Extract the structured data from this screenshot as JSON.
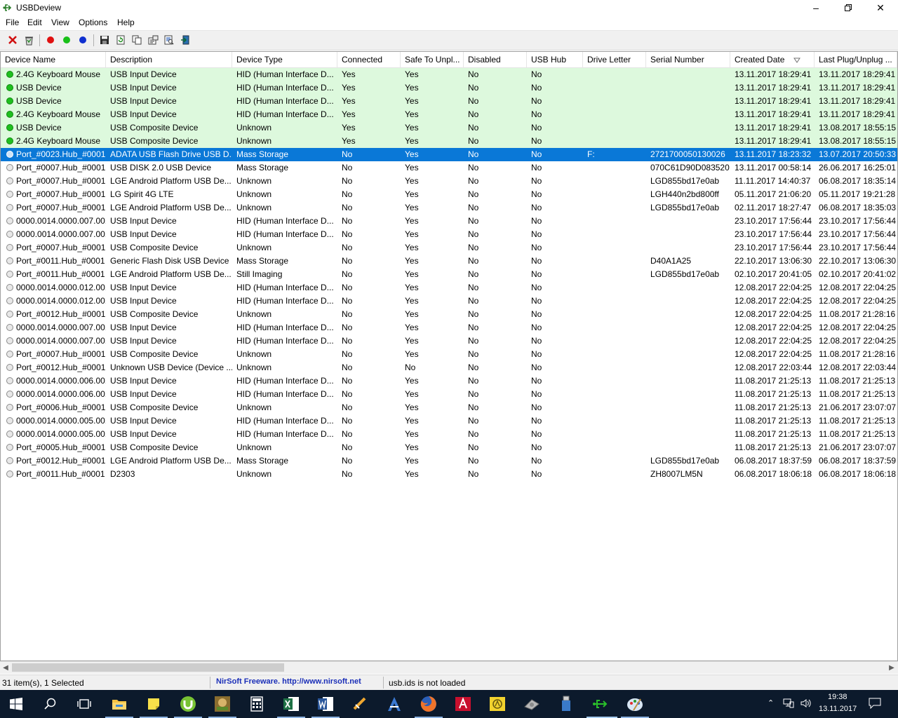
{
  "window": {
    "title": "USBDeview"
  },
  "menu": [
    "File",
    "Edit",
    "View",
    "Options",
    "Help"
  ],
  "columns": [
    "Device Name",
    "Description",
    "Device Type",
    "Connected",
    "Safe To Unpl...",
    "Disabled",
    "USB Hub",
    "Drive Letter",
    "Serial Number",
    "Created Date",
    "Last Plug/Unplug ..."
  ],
  "rows": [
    {
      "state": "connected",
      "cells": [
        "2.4G Keyboard Mouse",
        "USB Input Device",
        "HID (Human Interface D...",
        "Yes",
        "Yes",
        "No",
        "No",
        "",
        "",
        "13.11.2017 18:29:41",
        "13.11.2017 18:29:41"
      ]
    },
    {
      "state": "connected",
      "cells": [
        "USB Device",
        "USB Input Device",
        "HID (Human Interface D...",
        "Yes",
        "Yes",
        "No",
        "No",
        "",
        "",
        "13.11.2017 18:29:41",
        "13.11.2017 18:29:41"
      ]
    },
    {
      "state": "connected",
      "cells": [
        "USB Device",
        "USB Input Device",
        "HID (Human Interface D...",
        "Yes",
        "Yes",
        "No",
        "No",
        "",
        "",
        "13.11.2017 18:29:41",
        "13.11.2017 18:29:41"
      ]
    },
    {
      "state": "connected",
      "cells": [
        "2.4G Keyboard Mouse",
        "USB Input Device",
        "HID (Human Interface D...",
        "Yes",
        "Yes",
        "No",
        "No",
        "",
        "",
        "13.11.2017 18:29:41",
        "13.11.2017 18:29:41"
      ]
    },
    {
      "state": "connected",
      "cells": [
        "USB Device",
        "USB Composite Device",
        "Unknown",
        "Yes",
        "Yes",
        "No",
        "No",
        "",
        "",
        "13.11.2017 18:29:41",
        "13.08.2017 18:55:15"
      ]
    },
    {
      "state": "connected",
      "cells": [
        "2.4G Keyboard Mouse",
        "USB Composite Device",
        "Unknown",
        "Yes",
        "Yes",
        "No",
        "No",
        "",
        "",
        "13.11.2017 18:29:41",
        "13.08.2017 18:55:15"
      ]
    },
    {
      "state": "selected",
      "cells": [
        "Port_#0023.Hub_#0001",
        "ADATA USB Flash Drive USB D...",
        "Mass Storage",
        "No",
        "Yes",
        "No",
        "No",
        "F:",
        "2721700050130026",
        "13.11.2017 18:23:32",
        "13.07.2017 20:50:33"
      ]
    },
    {
      "state": "disconnected",
      "cells": [
        "Port_#0007.Hub_#0001",
        "USB DISK 2.0 USB Device",
        "Mass Storage",
        "No",
        "Yes",
        "No",
        "No",
        "",
        "070C61D90D083520",
        "13.11.2017 00:58:14",
        "26.06.2017 16:25:01"
      ]
    },
    {
      "state": "disconnected",
      "cells": [
        "Port_#0007.Hub_#0001",
        "LGE Android Platform USB De...",
        "Unknown",
        "No",
        "Yes",
        "No",
        "No",
        "",
        "LGD855bd17e0ab",
        "11.11.2017 14:40:37",
        "06.08.2017 18:35:14"
      ]
    },
    {
      "state": "disconnected",
      "cells": [
        "Port_#0007.Hub_#0001",
        "LG Spirit 4G LTE",
        "Unknown",
        "No",
        "Yes",
        "No",
        "No",
        "",
        "LGH440n2bd800ff",
        "05.11.2017 21:06:20",
        "05.11.2017 19:21:28"
      ]
    },
    {
      "state": "disconnected",
      "cells": [
        "Port_#0007.Hub_#0001",
        "LGE Android Platform USB De...",
        "Unknown",
        "No",
        "Yes",
        "No",
        "No",
        "",
        "LGD855bd17e0ab",
        "02.11.2017 18:27:47",
        "06.08.2017 18:35:03"
      ]
    },
    {
      "state": "disconnected",
      "cells": [
        "0000.0014.0000.007.00...",
        "USB Input Device",
        "HID (Human Interface D...",
        "No",
        "Yes",
        "No",
        "No",
        "",
        "",
        "23.10.2017 17:56:44",
        "23.10.2017 17:56:44"
      ]
    },
    {
      "state": "disconnected",
      "cells": [
        "0000.0014.0000.007.00...",
        "USB Input Device",
        "HID (Human Interface D...",
        "No",
        "Yes",
        "No",
        "No",
        "",
        "",
        "23.10.2017 17:56:44",
        "23.10.2017 17:56:44"
      ]
    },
    {
      "state": "disconnected",
      "cells": [
        "Port_#0007.Hub_#0001",
        "USB Composite Device",
        "Unknown",
        "No",
        "Yes",
        "No",
        "No",
        "",
        "",
        "23.10.2017 17:56:44",
        "23.10.2017 17:56:44"
      ]
    },
    {
      "state": "disconnected",
      "cells": [
        "Port_#0011.Hub_#0001",
        "Generic Flash Disk USB Device",
        "Mass Storage",
        "No",
        "Yes",
        "No",
        "No",
        "",
        "D40A1A25",
        "22.10.2017 13:06:30",
        "22.10.2017 13:06:30"
      ]
    },
    {
      "state": "disconnected",
      "cells": [
        "Port_#0011.Hub_#0001",
        "LGE Android Platform USB De...",
        "Still Imaging",
        "No",
        "Yes",
        "No",
        "No",
        "",
        "LGD855bd17e0ab",
        "02.10.2017 20:41:05",
        "02.10.2017 20:41:02"
      ]
    },
    {
      "state": "disconnected",
      "cells": [
        "0000.0014.0000.012.00...",
        "USB Input Device",
        "HID (Human Interface D...",
        "No",
        "Yes",
        "No",
        "No",
        "",
        "",
        "12.08.2017 22:04:25",
        "12.08.2017 22:04:25"
      ]
    },
    {
      "state": "disconnected",
      "cells": [
        "0000.0014.0000.012.00...",
        "USB Input Device",
        "HID (Human Interface D...",
        "No",
        "Yes",
        "No",
        "No",
        "",
        "",
        "12.08.2017 22:04:25",
        "12.08.2017 22:04:25"
      ]
    },
    {
      "state": "disconnected",
      "cells": [
        "Port_#0012.Hub_#0001",
        "USB Composite Device",
        "Unknown",
        "No",
        "Yes",
        "No",
        "No",
        "",
        "",
        "12.08.2017 22:04:25",
        "11.08.2017 21:28:16"
      ]
    },
    {
      "state": "disconnected",
      "cells": [
        "0000.0014.0000.007.00...",
        "USB Input Device",
        "HID (Human Interface D...",
        "No",
        "Yes",
        "No",
        "No",
        "",
        "",
        "12.08.2017 22:04:25",
        "12.08.2017 22:04:25"
      ]
    },
    {
      "state": "disconnected",
      "cells": [
        "0000.0014.0000.007.00...",
        "USB Input Device",
        "HID (Human Interface D...",
        "No",
        "Yes",
        "No",
        "No",
        "",
        "",
        "12.08.2017 22:04:25",
        "12.08.2017 22:04:25"
      ]
    },
    {
      "state": "disconnected",
      "cells": [
        "Port_#0007.Hub_#0001",
        "USB Composite Device",
        "Unknown",
        "No",
        "Yes",
        "No",
        "No",
        "",
        "",
        "12.08.2017 22:04:25",
        "11.08.2017 21:28:16"
      ]
    },
    {
      "state": "disconnected",
      "cells": [
        "Port_#0012.Hub_#0001",
        "Unknown USB Device (Device ...",
        "Unknown",
        "No",
        "No",
        "No",
        "No",
        "",
        "",
        "12.08.2017 22:03:44",
        "12.08.2017 22:03:44"
      ]
    },
    {
      "state": "disconnected",
      "cells": [
        "0000.0014.0000.006.00...",
        "USB Input Device",
        "HID (Human Interface D...",
        "No",
        "Yes",
        "No",
        "No",
        "",
        "",
        "11.08.2017 21:25:13",
        "11.08.2017 21:25:13"
      ]
    },
    {
      "state": "disconnected",
      "cells": [
        "0000.0014.0000.006.00...",
        "USB Input Device",
        "HID (Human Interface D...",
        "No",
        "Yes",
        "No",
        "No",
        "",
        "",
        "11.08.2017 21:25:13",
        "11.08.2017 21:25:13"
      ]
    },
    {
      "state": "disconnected",
      "cells": [
        "Port_#0006.Hub_#0001",
        "USB Composite Device",
        "Unknown",
        "No",
        "Yes",
        "No",
        "No",
        "",
        "",
        "11.08.2017 21:25:13",
        "21.06.2017 23:07:07"
      ]
    },
    {
      "state": "disconnected",
      "cells": [
        "0000.0014.0000.005.00...",
        "USB Input Device",
        "HID (Human Interface D...",
        "No",
        "Yes",
        "No",
        "No",
        "",
        "",
        "11.08.2017 21:25:13",
        "11.08.2017 21:25:13"
      ]
    },
    {
      "state": "disconnected",
      "cells": [
        "0000.0014.0000.005.00...",
        "USB Input Device",
        "HID (Human Interface D...",
        "No",
        "Yes",
        "No",
        "No",
        "",
        "",
        "11.08.2017 21:25:13",
        "11.08.2017 21:25:13"
      ]
    },
    {
      "state": "disconnected",
      "cells": [
        "Port_#0005.Hub_#0001",
        "USB Composite Device",
        "Unknown",
        "No",
        "Yes",
        "No",
        "No",
        "",
        "",
        "11.08.2017 21:25:13",
        "21.06.2017 23:07:07"
      ]
    },
    {
      "state": "disconnected",
      "cells": [
        "Port_#0012.Hub_#0001",
        "LGE Android Platform USB De...",
        "Mass Storage",
        "No",
        "Yes",
        "No",
        "No",
        "",
        "LGD855bd17e0ab",
        "06.08.2017 18:37:59",
        "06.08.2017 18:37:59"
      ]
    },
    {
      "state": "disconnected",
      "cells": [
        "Port_#0011.Hub_#0001",
        "D2303",
        "Unknown",
        "No",
        "Yes",
        "No",
        "No",
        "",
        "ZH8007LM5N",
        "06.08.2017 18:06:18",
        "06.08.2017 18:06:18"
      ]
    }
  ],
  "status": {
    "count": "31 item(s), 1 Selected",
    "freeware": "NirSoft Freeware.  http://www.nirsoft.net",
    "usbids": "usb.ids is not loaded"
  },
  "taskbar": {
    "time": "19:38",
    "date": "13.11.2017",
    "apps": [
      "start-icon",
      "search-icon",
      "task-view-icon",
      "file-explorer-icon",
      "sticky-notes-icon",
      "utorrent-icon",
      "game-icon",
      "calculator-icon",
      "excel-icon",
      "word-icon",
      "app-icon",
      "acrobat-icon",
      "firefox-icon",
      "autocad-icon",
      "app-yellow-icon",
      "hdd-icon",
      "usb-drive-icon",
      "usbdeview-icon",
      "paint-icon"
    ]
  },
  "colors": {
    "connected_row": "#ddf9dd",
    "selected_row": "#0a78d7",
    "accent": "#1b2fb8"
  }
}
